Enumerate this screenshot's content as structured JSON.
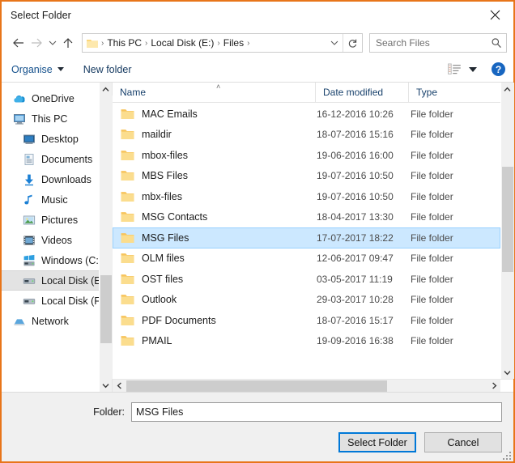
{
  "window": {
    "title": "Select Folder",
    "close_label": "✕",
    "close_icon": "close-icon",
    "border_color": "#e8751a"
  },
  "nav": {
    "back_label": "←",
    "forward_label": "→",
    "recent_label": "˅",
    "up_label": "↑",
    "breadcrumb": [
      "This PC",
      "Local Disk (E:)",
      "Files"
    ],
    "separator": "›",
    "dropdown_label": "˅",
    "refresh_label": "↻"
  },
  "search": {
    "placeholder": "Search Files",
    "value": "",
    "icon": "search-icon"
  },
  "toolbar": {
    "organise_label": "Organise",
    "new_folder_label": "New folder",
    "view_icon": "view-options-icon",
    "help_label": "?"
  },
  "sidebar": {
    "items": [
      {
        "label": "OneDrive",
        "icon": "onedrive-cloud-icon",
        "depth": 0,
        "selected": false
      },
      {
        "label": "This PC",
        "icon": "this-pc-monitor-icon",
        "depth": 0,
        "selected": false
      },
      {
        "label": "Desktop",
        "icon": "desktop-icon",
        "depth": 1,
        "selected": false
      },
      {
        "label": "Documents",
        "icon": "documents-icon",
        "depth": 1,
        "selected": false
      },
      {
        "label": "Downloads",
        "icon": "downloads-arrow-icon",
        "depth": 1,
        "selected": false
      },
      {
        "label": "Music",
        "icon": "music-note-icon",
        "depth": 1,
        "selected": false
      },
      {
        "label": "Pictures",
        "icon": "pictures-icon",
        "depth": 1,
        "selected": false
      },
      {
        "label": "Videos",
        "icon": "videos-icon",
        "depth": 1,
        "selected": false
      },
      {
        "label": "Windows (C:)",
        "icon": "windows-drive-icon",
        "depth": 1,
        "selected": false
      },
      {
        "label": "Local Disk (E:)",
        "icon": "drive-icon",
        "depth": 1,
        "selected": true
      },
      {
        "label": "Local Disk (F:)",
        "icon": "drive-icon",
        "depth": 1,
        "selected": false
      },
      {
        "label": "Network",
        "icon": "network-icon",
        "depth": 0,
        "selected": false
      }
    ],
    "scroll": {
      "up_label": "˄",
      "down_label": "˅"
    }
  },
  "list": {
    "columns": [
      "Name",
      "Date modified",
      "Type"
    ],
    "sort_column": "Name",
    "sort_caret": "˄",
    "rows": [
      {
        "name": "MAC Emails",
        "date": "16-12-2016 10:26",
        "type": "File folder",
        "selected": false
      },
      {
        "name": "maildir",
        "date": "18-07-2016 15:16",
        "type": "File folder",
        "selected": false
      },
      {
        "name": "mbox-files",
        "date": "19-06-2016 16:00",
        "type": "File folder",
        "selected": false
      },
      {
        "name": "MBS Files",
        "date": "19-07-2016 10:50",
        "type": "File folder",
        "selected": false
      },
      {
        "name": "mbx-files",
        "date": "19-07-2016 10:50",
        "type": "File folder",
        "selected": false
      },
      {
        "name": "MSG Contacts",
        "date": "18-04-2017 13:30",
        "type": "File folder",
        "selected": false
      },
      {
        "name": "MSG Files",
        "date": "17-07-2017 18:22",
        "type": "File folder",
        "selected": true
      },
      {
        "name": "OLM files",
        "date": "12-06-2017 09:47",
        "type": "File folder",
        "selected": false
      },
      {
        "name": "OST files",
        "date": "03-05-2017 11:19",
        "type": "File folder",
        "selected": false
      },
      {
        "name": "Outlook",
        "date": "29-03-2017 10:28",
        "type": "File folder",
        "selected": false
      },
      {
        "name": "PDF Documents",
        "date": "18-07-2016 15:17",
        "type": "File folder",
        "selected": false
      },
      {
        "name": "PMAIL",
        "date": "19-09-2016 16:38",
        "type": "File folder",
        "selected": false
      }
    ],
    "vscroll": {
      "up_label": "˄",
      "down_label": "˅"
    },
    "hscroll": {
      "left_label": "‹",
      "right_label": "›"
    }
  },
  "footer": {
    "folder_label": "Folder:",
    "folder_value": "MSG Files",
    "select_label": "Select Folder",
    "cancel_label": "Cancel"
  },
  "colors": {
    "selection_blue": "#cce8ff",
    "default_button_border": "#0078d7",
    "link_blue": "#14508c",
    "header_blue": "#17406b"
  }
}
